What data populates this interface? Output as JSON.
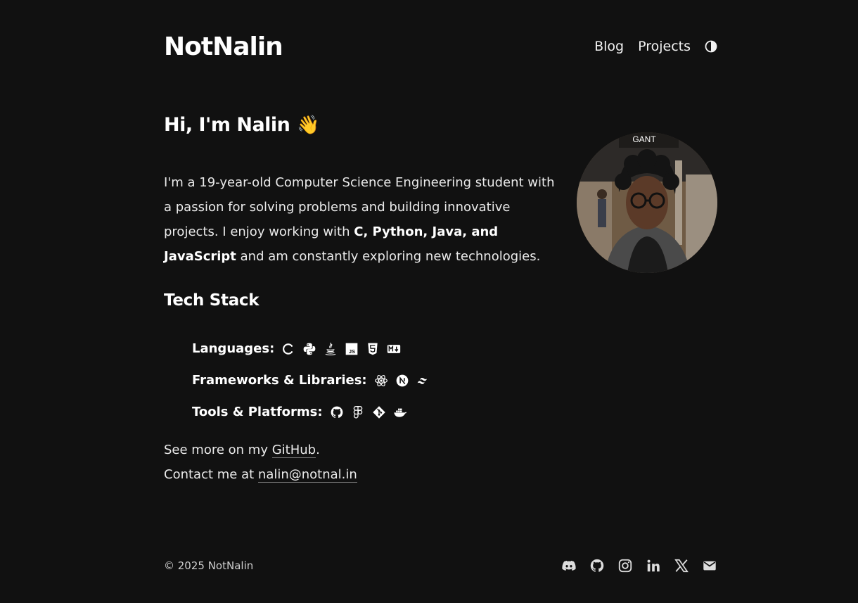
{
  "header": {
    "brand": "NotNalin",
    "nav": [
      {
        "label": "Blog"
      },
      {
        "label": "Projects"
      }
    ],
    "theme_icon": "contrast-icon"
  },
  "hero": {
    "title": "Hi, I'm Nalin",
    "wave_emoji": "👋",
    "bio_part1": "I'm a 19-year-old Computer Science Engineering student with a passion for solving problems and building innovative projects. I enjoy working with ",
    "bio_bold": "C, Python, Java, and JavaScript",
    "bio_part2": " and am constantly exploring new technologies.",
    "avatar_icon": "profile-photo"
  },
  "tech_stack": {
    "title": "Tech Stack",
    "languages": {
      "label": "Languages:",
      "icons": [
        "c-icon",
        "python-icon",
        "java-icon",
        "javascript-icon",
        "html5-icon",
        "markdown-icon"
      ]
    },
    "frameworks": {
      "label": "Frameworks & Libraries:",
      "icons": [
        "react-icon",
        "nextjs-icon",
        "tailwind-icon"
      ]
    },
    "tools": {
      "label": "Tools & Platforms:",
      "icons": [
        "github-icon",
        "figma-icon",
        "git-icon",
        "docker-icon"
      ]
    }
  },
  "more": {
    "github_prefix": "See more on my ",
    "github_link": "GitHub",
    "github_suffix": ".",
    "contact_prefix": "Contact me at ",
    "email": "nalin@notnal.in"
  },
  "footer": {
    "copyright": "© 2025 NotNalin",
    "social_icons": [
      "discord-icon",
      "github-icon",
      "instagram-icon",
      "linkedin-icon",
      "x-icon",
      "mail-icon"
    ]
  },
  "colors": {
    "background": "#111111",
    "text": "#f2f2f2",
    "link_underline": "#777777"
  }
}
